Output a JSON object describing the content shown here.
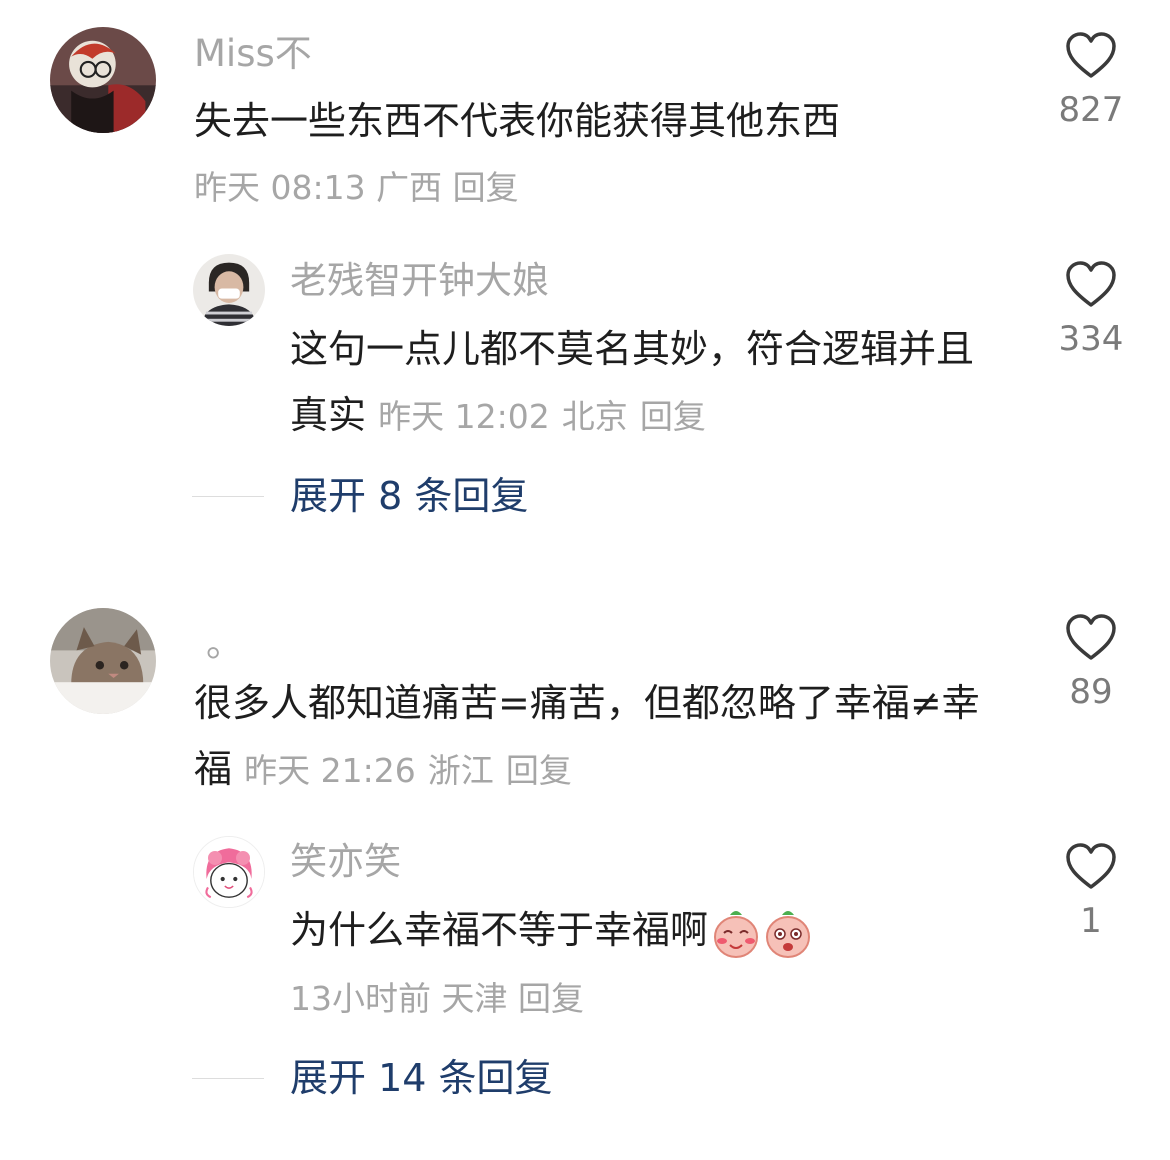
{
  "comments": [
    {
      "user": "Miss不",
      "text": "失去一些东西不代表你能获得其他东西",
      "time": "昨天 08:13",
      "location": "广西",
      "reply_label": "回复",
      "likes": "827",
      "replies": [
        {
          "user": "老残智开钟大娘",
          "text": "这句一点儿都不莫名其妙，符合逻辑并且真实",
          "time": "昨天 12:02",
          "location": "北京",
          "reply_label": "回复",
          "likes": "334"
        }
      ],
      "expand_label": "展开 8 条回复"
    },
    {
      "user": "。",
      "text": "很多人都知道痛苦=痛苦，但都忽略了幸福≠幸福",
      "time": "昨天 21:26",
      "location": "浙江",
      "reply_label": "回复",
      "likes": "89",
      "replies": [
        {
          "user": "笑亦笑",
          "text": "为什么幸福不等于幸福啊",
          "emojis": [
            "bashful-emoji",
            "surprised-emoji"
          ],
          "time": "13小时前",
          "location": "天津",
          "reply_label": "回复",
          "likes": "1"
        }
      ],
      "expand_label": "展开 14 条回复"
    }
  ],
  "colors": {
    "username": "#a6a6a6",
    "body_text": "#1e1e1e",
    "meta": "#a6a6a6",
    "expand_link": "#1f3d6b",
    "like_icon": "#3a3a3a"
  },
  "icons": [
    "heart-outline-icon"
  ]
}
